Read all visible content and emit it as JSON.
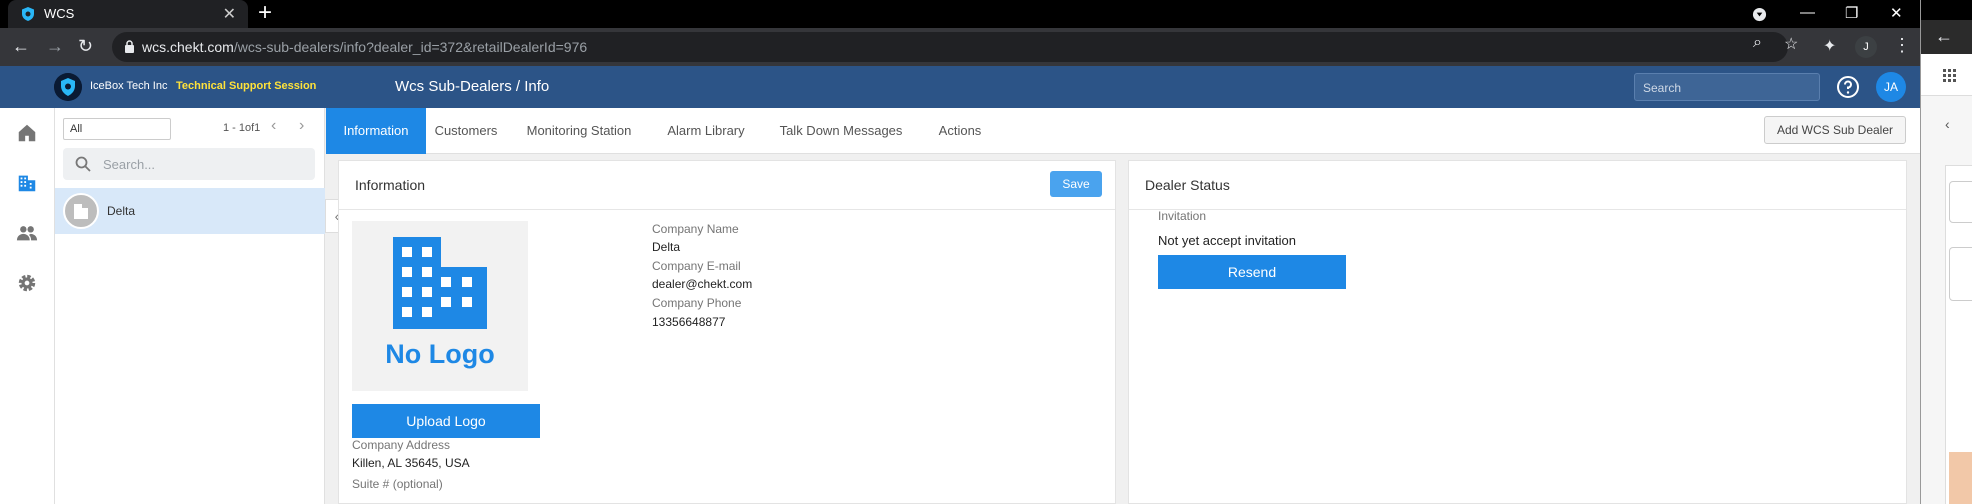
{
  "browser": {
    "tab_title": "WCS",
    "url_host": "wcs.chekt.com",
    "url_path": "/wcs-sub-dealers/info?dealer_id=372&retailDealerId=976",
    "profile_initial": "J"
  },
  "header": {
    "brand": "IceBox Tech Inc",
    "session": "Technical Support Session",
    "breadcrumb": "Wcs Sub-Dealers / Info",
    "search_placeholder": "Search",
    "avatar": "JA"
  },
  "list": {
    "filter": "All",
    "pager": "1 - 1of1",
    "search_placeholder": "Search...",
    "items": [
      {
        "name": "Delta"
      }
    ]
  },
  "tabs": [
    {
      "label": "Information",
      "active": true
    },
    {
      "label": "Customers"
    },
    {
      "label": "Monitoring Station"
    },
    {
      "label": "Alarm Library"
    },
    {
      "label": "Talk Down Messages"
    },
    {
      "label": "Actions"
    }
  ],
  "add_button": "Add WCS Sub Dealer",
  "info_card": {
    "title": "Information",
    "save": "Save",
    "no_logo": "No Logo",
    "upload": "Upload Logo",
    "company_name_label": "Company Name",
    "company_name": "Delta",
    "email_label": "Company E-mail",
    "email": "dealer@chekt.com",
    "phone_label": "Company Phone",
    "phone": "13356648877",
    "address_label": "Company Address",
    "address": "Killen, AL 35645, USA",
    "suite_label": "Suite # (optional)"
  },
  "status_card": {
    "title": "Dealer Status",
    "invitation_label": "Invitation",
    "invitation_status": "Not yet accept invitation",
    "resend": "Resend"
  },
  "colors": {
    "header_bg": "#2c5487",
    "accent": "#1e88e5",
    "session_text": "#ffe23a",
    "selected_row": "#d8e8f9"
  }
}
